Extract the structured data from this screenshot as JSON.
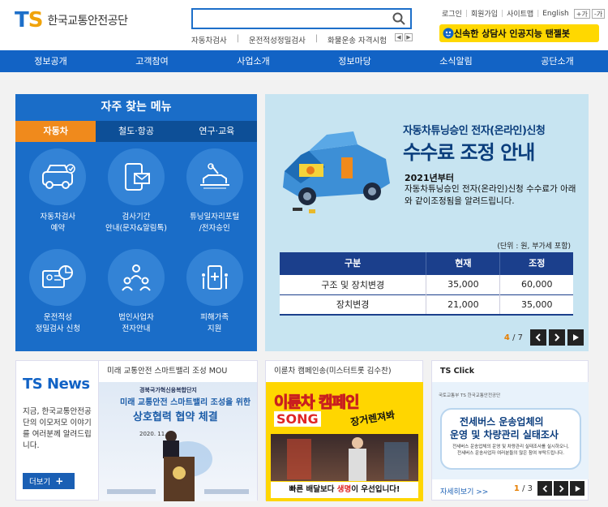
{
  "header": {
    "logo_mark_t": "T",
    "logo_mark_s": "S",
    "logo_name": "한국교통안전공단",
    "search_placeholder": "",
    "keywords": [
      "자동차검사",
      "운전적성정밀검사",
      "화물운송 자격시험"
    ],
    "util_links": [
      "로그인",
      "회원가입",
      "사이트맵",
      "English"
    ],
    "zoom_in": "+가",
    "zoom_out": "-가",
    "chatbot_label": "신속한 상담사 인공지능 탠젤봇"
  },
  "nav": {
    "items": [
      "정보공개",
      "고객참여",
      "사업소개",
      "정보마당",
      "소식알림",
      "공단소개"
    ]
  },
  "freq": {
    "title": "자주 찾는 메뉴",
    "tabs": [
      "자동차",
      "철도·항공",
      "연구·교육"
    ],
    "items": [
      {
        "line1": "자동차검사",
        "line2": "예약"
      },
      {
        "line1": "검사기간",
        "line2": "안내(문자&알림톡)"
      },
      {
        "line1": "튜닝일자리포털",
        "line2": "/전자승인"
      },
      {
        "line1": "운전적성",
        "line2": "정밀검사 신청"
      },
      {
        "line1": "법인사업자",
        "line2": "전자안내"
      },
      {
        "line1": "피해가족",
        "line2": "지원"
      }
    ]
  },
  "banner": {
    "sub": "자동차튜닝승인 전자(온라인)신청",
    "main": "수수료 조정 안내",
    "year": "2021년부터",
    "desc": "자동차튜닝승인 전자(온라인)신청 수수료가 아래와 같이조정됨을 알려드립니다.",
    "unit": "(단위 : 원, 부가세 포함)",
    "headers": [
      "구분",
      "현재",
      "조정"
    ],
    "rows": [
      [
        "구조 및 장치변경",
        "35,000",
        "60,000"
      ],
      [
        "장치변경",
        "21,000",
        "35,000"
      ]
    ],
    "page_current": "4",
    "page_sep": " / ",
    "page_total": "7"
  },
  "news": {
    "title": "TS News",
    "desc": "지금, 한국교통안전공단의 이모저모 이야기를 여러분께 알려드립니다.",
    "more": "더보기"
  },
  "mou": {
    "head": "미래 교통안전 스마트밸리 조성 MOU",
    "t1": "경북국가혁신융복합단지",
    "t2": "미래 교통안전 스마트밸리 조성을 위한",
    "t3": "상호협력 협약 체결",
    "t4": "2020. 11. 4."
  },
  "song": {
    "head": "이륜차 캠페인송(미스터트롯 김수찬)",
    "t1": "이륜차 캠페인",
    "t2": "SONG",
    "t3": "장거렌져봐",
    "bottom_a": "빠른 배달보다 ",
    "bottom_red": "생명",
    "bottom_b": "이 우선입니다!"
  },
  "click": {
    "head": "TS Click",
    "logo": "국토교통부  TS 한국교통안전공단",
    "t1": "전세버스 운송업체의",
    "t2": "운영 및 차량관리 실태조사",
    "t3": "전세버스 운송업체의 운영 및 차량관리 실태조사를 실시하오니, 전세버스 운송사업자 여러분들의 많은 참여 부탁드립니다.",
    "more": "자세히보기 >>",
    "page_current": "1",
    "page_sep": " / ",
    "page_total": "3"
  },
  "colors": {
    "brand_blue": "#1263c5",
    "accent_orange": "#f08a1c",
    "chatbot_yellow": "#ffd800"
  }
}
